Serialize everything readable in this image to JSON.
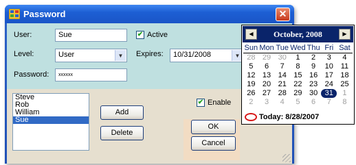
{
  "window": {
    "title": "Password",
    "close_glyph": "✕"
  },
  "form": {
    "user_label": "User:",
    "user_value": "Sue",
    "active_label": "Active",
    "active_checked": true,
    "level_label": "Level:",
    "level_value": "User",
    "expires_label": "Expires:",
    "expires_value": "10/31/2008",
    "password_label": "Password:",
    "password_value": "xxxxxx"
  },
  "users": {
    "items": [
      "Steve",
      "Rob",
      "William",
      "Sue"
    ],
    "selected": "Sue"
  },
  "buttons": {
    "add": "Add",
    "delete": "Delete",
    "ok": "OK",
    "cancel": "Cancel"
  },
  "enable": {
    "label": "Enable",
    "checked": true
  },
  "calendar": {
    "prev_glyph": "◀",
    "next_glyph": "▶",
    "month": "October, 2008",
    "dow": [
      "Sun",
      "Mon",
      "Tue",
      "Wed",
      "Thu",
      "Fri",
      "Sat"
    ],
    "weeks": [
      [
        "28",
        "29",
        "30",
        "1",
        "2",
        "3",
        "4"
      ],
      [
        "5",
        "6",
        "7",
        "8",
        "9",
        "10",
        "11"
      ],
      [
        "12",
        "13",
        "14",
        "15",
        "16",
        "17",
        "18"
      ],
      [
        "19",
        "20",
        "21",
        "22",
        "23",
        "24",
        "25"
      ],
      [
        "26",
        "27",
        "28",
        "29",
        "30",
        "31",
        "1"
      ],
      [
        "2",
        "3",
        "4",
        "5",
        "6",
        "7",
        "8"
      ]
    ],
    "selected_day": "31",
    "today_label": "Today: 8/28/2007"
  },
  "colors": {
    "title_bar": "#1d5fd4",
    "calendar_header": "#0a246a",
    "selection": "#316ac5"
  },
  "icons": {
    "app": "app-grid-icon",
    "close": "close-icon",
    "dropdown": "chevron-down-icon"
  }
}
